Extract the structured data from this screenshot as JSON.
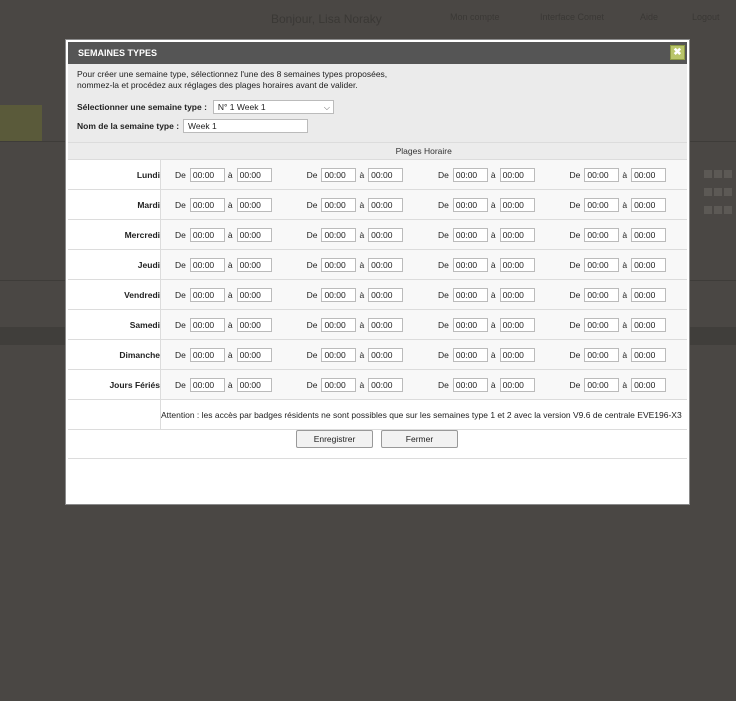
{
  "background": {
    "greeting": "Bonjour, Lisa Noraky",
    "links": [
      "Mon compte",
      "Interface Comet",
      "Aide",
      "Logout"
    ]
  },
  "modal": {
    "title": "SEMAINES TYPES",
    "close_glyph": "✖",
    "intro_line1": "Pour créer une semaine type, sélectionnez l'une des 8 semaines types proposées,",
    "intro_line2": "nommez-la et procédez aux réglages des plages horaires avant de valider.",
    "select_label": "Sélectionner une semaine type :",
    "select_value": "N° 1 Week 1",
    "name_label": "Nom de la semaine type :",
    "name_value": "Week 1",
    "table_header": "Plages Horaire",
    "from_label": "De",
    "to_label": "à",
    "days": [
      {
        "name": "Lundi",
        "slots": [
          [
            "00:00",
            "00:00"
          ],
          [
            "00:00",
            "00:00"
          ],
          [
            "00:00",
            "00:00"
          ],
          [
            "00:00",
            "00:00"
          ]
        ]
      },
      {
        "name": "Mardi",
        "slots": [
          [
            "00:00",
            "00:00"
          ],
          [
            "00:00",
            "00:00"
          ],
          [
            "00:00",
            "00:00"
          ],
          [
            "00:00",
            "00:00"
          ]
        ]
      },
      {
        "name": "Mercredi",
        "slots": [
          [
            "00:00",
            "00:00"
          ],
          [
            "00:00",
            "00:00"
          ],
          [
            "00:00",
            "00:00"
          ],
          [
            "00:00",
            "00:00"
          ]
        ]
      },
      {
        "name": "Jeudi",
        "slots": [
          [
            "00:00",
            "00:00"
          ],
          [
            "00:00",
            "00:00"
          ],
          [
            "00:00",
            "00:00"
          ],
          [
            "00:00",
            "00:00"
          ]
        ]
      },
      {
        "name": "Vendredi",
        "slots": [
          [
            "00:00",
            "00:00"
          ],
          [
            "00:00",
            "00:00"
          ],
          [
            "00:00",
            "00:00"
          ],
          [
            "00:00",
            "00:00"
          ]
        ]
      },
      {
        "name": "Samedi",
        "slots": [
          [
            "00:00",
            "00:00"
          ],
          [
            "00:00",
            "00:00"
          ],
          [
            "00:00",
            "00:00"
          ],
          [
            "00:00",
            "00:00"
          ]
        ]
      },
      {
        "name": "Dimanche",
        "slots": [
          [
            "00:00",
            "00:00"
          ],
          [
            "00:00",
            "00:00"
          ],
          [
            "00:00",
            "00:00"
          ],
          [
            "00:00",
            "00:00"
          ]
        ]
      },
      {
        "name": "Jours Fériés",
        "slots": [
          [
            "00:00",
            "00:00"
          ],
          [
            "00:00",
            "00:00"
          ],
          [
            "00:00",
            "00:00"
          ],
          [
            "00:00",
            "00:00"
          ]
        ]
      }
    ],
    "note": "Attention : les accès par badges résidents ne sont possibles que sur les semaines type 1 et 2 avec la version V9.6 de centrale EVE196-X3",
    "save_label": "Enregistrer",
    "close_label": "Fermer",
    "note_color": "#1a1aff",
    "title_bar_color": "#555555",
    "close_button_color": "#b9c56a"
  }
}
